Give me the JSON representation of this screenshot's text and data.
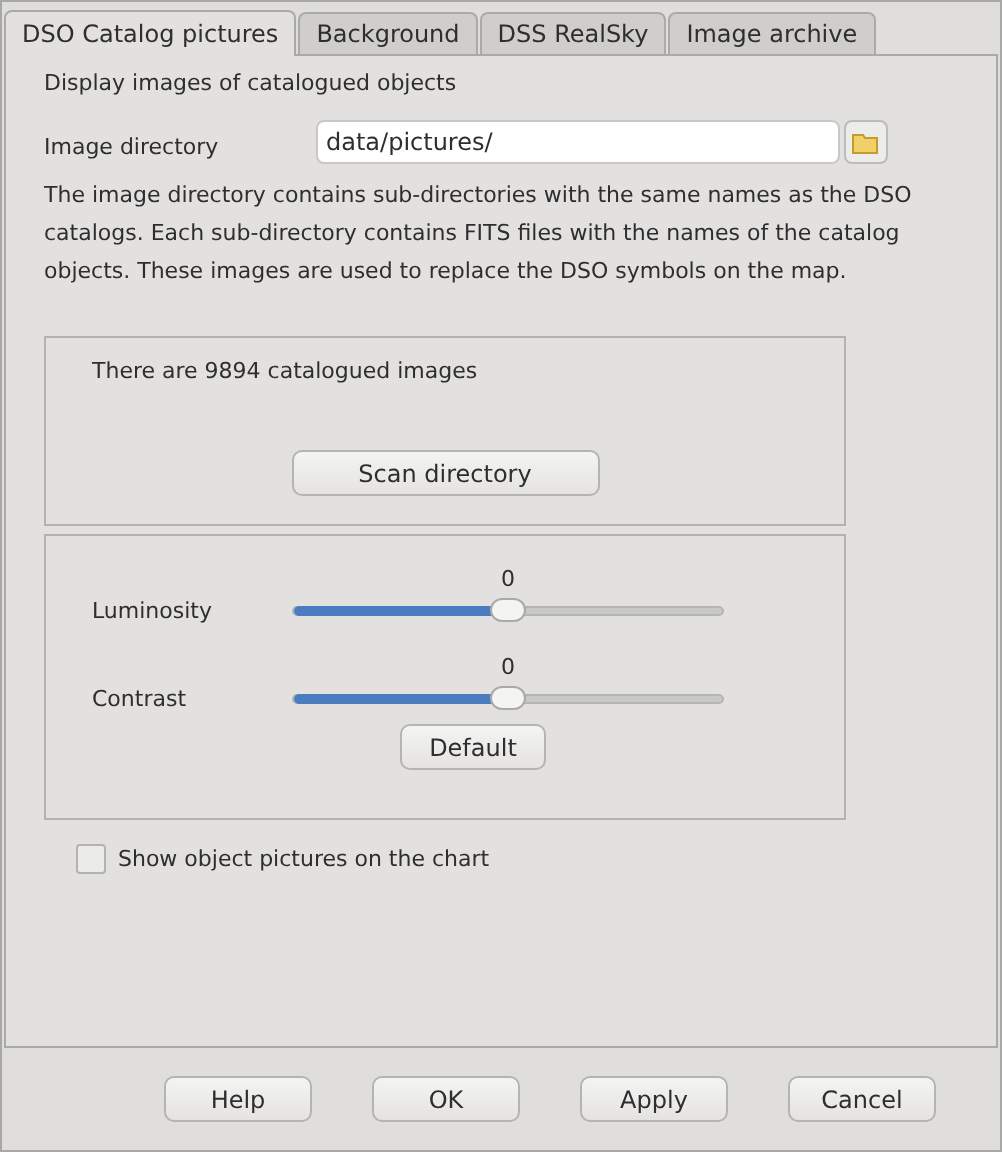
{
  "tabs": [
    {
      "label": "DSO Catalog pictures",
      "selected": true
    },
    {
      "label": "Background",
      "selected": false
    },
    {
      "label": "DSS RealSky",
      "selected": false
    },
    {
      "label": "Image archive",
      "selected": false
    }
  ],
  "heading": "Display images of catalogued objects",
  "image_directory": {
    "label": "Image directory",
    "value": "data/pictures/"
  },
  "description": "The image directory contains sub-directories with the same names as the DSO catalogs. Each sub-directory contains FITS files with the names of the catalog objects. These images are used to replace the DSO symbols on the map.",
  "catalog": {
    "count_text": "There are 9894 catalogued images",
    "scan_button": "Scan directory"
  },
  "sliders": [
    {
      "label": "Luminosity",
      "reading": "0",
      "level": 0.5
    },
    {
      "label": "Contrast",
      "reading": "0",
      "level": 0.5
    }
  ],
  "default_button": "Default",
  "show_pictures": {
    "label": "Show object pictures on the chart",
    "checked": false
  },
  "buttons": [
    "Help",
    "OK",
    "Apply",
    "Cancel"
  ]
}
